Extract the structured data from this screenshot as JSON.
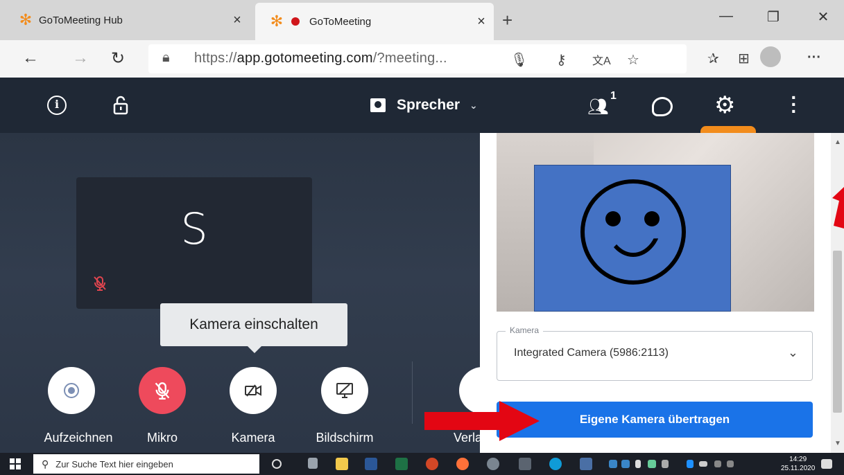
{
  "browser": {
    "tabs": [
      {
        "title": "GoToMeeting Hub"
      },
      {
        "title": "GoToMeeting"
      }
    ],
    "url_proto": "https://",
    "url_host": "app.gotomeeting.com",
    "url_rest": "/?meeting...",
    "close_glyph": "×"
  },
  "header": {
    "view_label": "Sprecher",
    "participant_count": "1"
  },
  "stage": {
    "participant_initial": "S",
    "tooltip": "Kamera einschalten",
    "controls": [
      {
        "label": "Aufzeichnen"
      },
      {
        "label": "Mikro"
      },
      {
        "label": "Kamera"
      },
      {
        "label": "Bildschirm"
      },
      {
        "label": "Verla"
      }
    ]
  },
  "panel": {
    "camera_select_label": "Kamera",
    "camera_select_value": "Integrated Camera (5986:2113)",
    "share_button": "Eigene Kamera übertragen"
  },
  "taskbar": {
    "search_placeholder": "Zur Suche Text hier eingeben",
    "time": "14:29",
    "date": "25.11.2020"
  },
  "colors": {
    "brand_orange": "#f28c1c",
    "header_bg": "#1f2835",
    "mic_muted": "#ee4a5c",
    "primary_button": "#1a73e8",
    "annotation_red": "#e30613"
  }
}
